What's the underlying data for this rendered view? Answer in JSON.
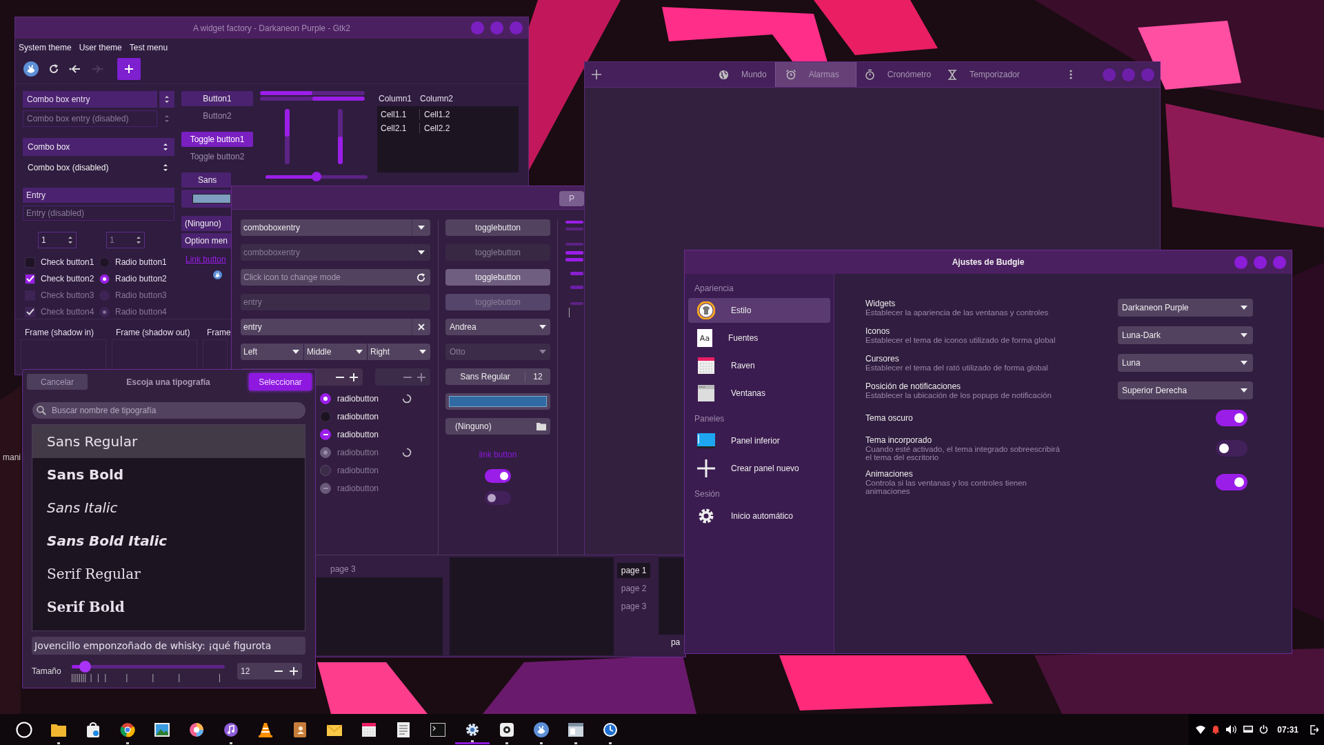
{
  "desktop_fragment": "mani",
  "widget_factory": {
    "title": "A widget factory - Darkaneon Purple - Gtk2",
    "menu": [
      "System theme",
      "User theme",
      "Test menu"
    ],
    "toolbar": [
      {
        "disabled": false
      },
      {
        "disabled": false
      },
      {
        "disabled": false
      },
      {
        "disabled": true
      }
    ],
    "combo_entries": [
      {
        "value": "Combo box entry",
        "disabled": false
      },
      {
        "value": "Combo box entry (disabled)",
        "disabled": true
      }
    ],
    "combos": [
      {
        "value": "Combo box",
        "disabled": false
      },
      {
        "value": "Combo box (disabled)",
        "disabled": true
      }
    ],
    "entries": [
      {
        "value": "Entry",
        "disabled": false
      },
      {
        "value": "Entry (disabled)",
        "disabled": true
      }
    ],
    "spins": [
      {
        "value": "1",
        "disabled": false
      },
      {
        "value": "1",
        "disabled": true
      }
    ],
    "checks": [
      {
        "label": "Check button1",
        "checked": false,
        "disabled": false
      },
      {
        "label": "Check button2",
        "checked": true,
        "disabled": false
      },
      {
        "label": "Check button3",
        "checked": false,
        "disabled": true
      },
      {
        "label": "Check button4",
        "checked": true,
        "disabled": true
      }
    ],
    "radios": [
      {
        "label": "Radio button1",
        "selected": false,
        "disabled": false
      },
      {
        "label": "Radio button2",
        "selected": true,
        "disabled": false
      },
      {
        "label": "Radio button3",
        "selected": false,
        "disabled": true
      },
      {
        "label": "Radio button4",
        "selected": true,
        "disabled": true
      }
    ],
    "buttons": [
      {
        "label": "Button1",
        "flat": false
      },
      {
        "label": "Button2",
        "flat": true
      }
    ],
    "toggles": [
      {
        "label": "Toggle button1",
        "on": true
      },
      {
        "label": "Toggle button2",
        "on": false
      }
    ],
    "font_button": "Sans",
    "file_button": "(Ninguno)",
    "option_menu": "Option men",
    "link": "Link button",
    "progress_bars": [
      {
        "level": 0.5,
        "inverted": false
      },
      {
        "level": 0.5,
        "inverted": true
      }
    ],
    "vertical_bars": [
      {
        "level": 0.5,
        "inverted": false
      },
      {
        "level": 0.5,
        "inverted": true
      }
    ],
    "slider": {
      "level": 0.5
    },
    "tree": {
      "columns": [
        "Column1",
        "Column2"
      ],
      "rows": [
        [
          "Cell1.1",
          "Cell1.2"
        ],
        [
          "Cell2.1",
          "Cell2.2"
        ]
      ]
    },
    "frames": [
      "Frame (shadow in)",
      "Frame (shadow out)",
      "Frame"
    ]
  },
  "gtk3_dialog": {
    "header_button": "P",
    "combo_entries": [
      {
        "value": "comboboxentry",
        "disabled": false
      },
      {
        "value": "comboboxentry",
        "disabled": true
      }
    ],
    "entries": [
      {
        "placeholder": "Click icon to change mode",
        "kind": "refresh",
        "disabled": false
      },
      {
        "value": "entry",
        "kind": "plain",
        "disabled": true
      },
      {
        "value": "entry",
        "kind": "clear",
        "disabled": false
      }
    ],
    "linked_combos": [
      "Left",
      "Middle",
      "Right"
    ],
    "spins": [
      {
        "disabled": false
      },
      {
        "disabled": true
      }
    ],
    "radios": [
      {
        "label": "radiobutton",
        "selected": true,
        "inconsistent": false,
        "disabled": false,
        "spinner": true
      },
      {
        "label": "radiobutton",
        "selected": false,
        "inconsistent": false,
        "disabled": false,
        "spinner": false
      },
      {
        "label": "radiobutton",
        "selected": true,
        "inconsistent": true,
        "disabled": false,
        "spinner": false
      },
      {
        "label": "radiobutton",
        "selected": true,
        "inconsistent": false,
        "disabled": true,
        "spinner": true
      },
      {
        "label": "radiobutton",
        "selected": false,
        "inconsistent": false,
        "disabled": true,
        "spinner": false
      },
      {
        "label": "radiobutton",
        "selected": true,
        "inconsistent": true,
        "disabled": true,
        "spinner": false
      }
    ],
    "toggles": [
      {
        "label": "togglebutton",
        "on": false,
        "disabled": false
      },
      {
        "label": "togglebutton",
        "on": false,
        "disabled": true
      },
      {
        "label": "togglebutton",
        "on": true,
        "disabled": false
      },
      {
        "label": "togglebutton",
        "on": true,
        "disabled": true
      }
    ],
    "combos": [
      {
        "value": "Andrea",
        "disabled": false
      },
      {
        "value": "Otto",
        "disabled": true
      }
    ],
    "font_button": {
      "name": "Sans Regular",
      "size": "12"
    },
    "file_button": "(Ninguno)",
    "link": "link button",
    "switches": [
      {
        "on": true
      },
      {
        "on": false
      }
    ],
    "notebook_left": {
      "tabs": [
        "page 3"
      ]
    },
    "notebook_right": {
      "tabs": [
        {
          "label": "page 1",
          "selected": true
        },
        {
          "label": "page 2",
          "selected": false
        },
        {
          "label": "page 3",
          "selected": false
        }
      ]
    },
    "notebook_bottom": {
      "tabs": [
        "pa"
      ]
    }
  },
  "font_chooser": {
    "cancel": "Cancelar",
    "title": "Escoja una tipografía",
    "select": "Seleccionar",
    "search_placeholder": "Buscar nombre de tipografía",
    "fonts": [
      {
        "name": "Sans Regular",
        "kind": "sans",
        "selected": true
      },
      {
        "name": "Sans Bold",
        "kind": "sans-bold",
        "selected": false
      },
      {
        "name": "Sans Italic",
        "kind": "sans-italic",
        "selected": false
      },
      {
        "name": "Sans Bold Italic",
        "kind": "sans-bold-italic",
        "selected": false
      },
      {
        "name": "Serif Regular",
        "kind": "serif",
        "selected": false
      },
      {
        "name": "Serif Bold",
        "kind": "serif-bold",
        "selected": false
      }
    ],
    "preview": "Jovencillo emponzoñado de whisky: ¡qué figurota",
    "size_label": "Tamaño",
    "size_slider": {
      "level": 0.09
    },
    "size_value": "12"
  },
  "clocks": {
    "tabs": [
      {
        "label": "Mundo",
        "selected": false
      },
      {
        "label": "Alarmas",
        "selected": true
      },
      {
        "label": "Cronómetro",
        "selected": false
      },
      {
        "label": "Temporizador",
        "selected": false
      }
    ]
  },
  "budgie": {
    "title": "Ajustes de Budgie",
    "sections": [
      {
        "heading": "Apariencia",
        "items": [
          {
            "label": "Estilo",
            "selected": true
          },
          {
            "label": "Fuentes",
            "selected": false,
            "icon_text": "Aa"
          },
          {
            "label": "Raven",
            "selected": false
          },
          {
            "label": "Ventanas",
            "selected": false
          }
        ]
      },
      {
        "heading": "Paneles",
        "items": [
          {
            "label": "Panel inferior",
            "selected": false
          },
          {
            "label": "Crear panel nuevo",
            "selected": false
          }
        ]
      },
      {
        "heading": "Sesión",
        "items": [
          {
            "label": "Inicio automático",
            "selected": false
          }
        ]
      }
    ],
    "settings": [
      {
        "title": "Widgets",
        "description": "Establecer la apariencia de las ventanas y controles",
        "kind": "dropdown",
        "value": "Darkaneon Purple"
      },
      {
        "title": "Iconos",
        "description": "Establecer el tema de iconos utilizado de forma global",
        "kind": "dropdown",
        "value": "Luna-Dark"
      },
      {
        "title": "Cursores",
        "description": "Establecer el tema del rató utilizado de forma global",
        "kind": "dropdown",
        "value": "Luna"
      },
      {
        "title": "Posición de notificaciones",
        "description": "Establecer la ubicación de los popups de notificación",
        "kind": "dropdown",
        "value": "Superior Derecha"
      },
      {
        "title": "Tema oscuro",
        "kind": "switch",
        "on": true
      },
      {
        "title": "Tema incorporado",
        "description": "Cuando esté activado, el tema integrado sobreescribirá el tema del escritorio",
        "kind": "switch",
        "on": false
      },
      {
        "title": "Animaciones",
        "description": "Controla si las ventanas y los controles tienen animaciones",
        "kind": "switch",
        "on": true
      }
    ]
  },
  "taskbar": {
    "apps": [
      {
        "running": true,
        "active": false
      },
      {
        "running": false,
        "active": false
      },
      {
        "running": true,
        "active": false
      },
      {
        "running": false,
        "active": false
      },
      {
        "running": false,
        "active": false
      },
      {
        "running": true,
        "active": false
      },
      {
        "running": false,
        "active": false
      },
      {
        "running": false,
        "active": false
      },
      {
        "running": false,
        "active": false
      },
      {
        "running": false,
        "active": false
      },
      {
        "running": false,
        "active": false
      },
      {
        "running": false,
        "active": false
      },
      {
        "running": true,
        "active": true
      },
      {
        "running": true,
        "active": false
      },
      {
        "running": true,
        "active": false
      },
      {
        "running": true,
        "active": false
      },
      {
        "running": true,
        "active": false
      }
    ],
    "clock": "07:31"
  }
}
